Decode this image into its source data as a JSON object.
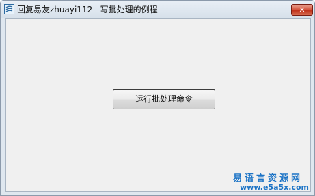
{
  "window": {
    "title": "回复易友zhuayi112   写批处理的例程",
    "app_icon": "app-logo-icon",
    "close_icon": "close-icon",
    "close_glyph": "✕",
    "close_color": "#c7432b"
  },
  "main": {
    "run_button_label": "运行批处理命令"
  },
  "watermark": {
    "text": "易语言资源网",
    "url": "www.e5a5x.com",
    "color": "#1d74c6"
  }
}
